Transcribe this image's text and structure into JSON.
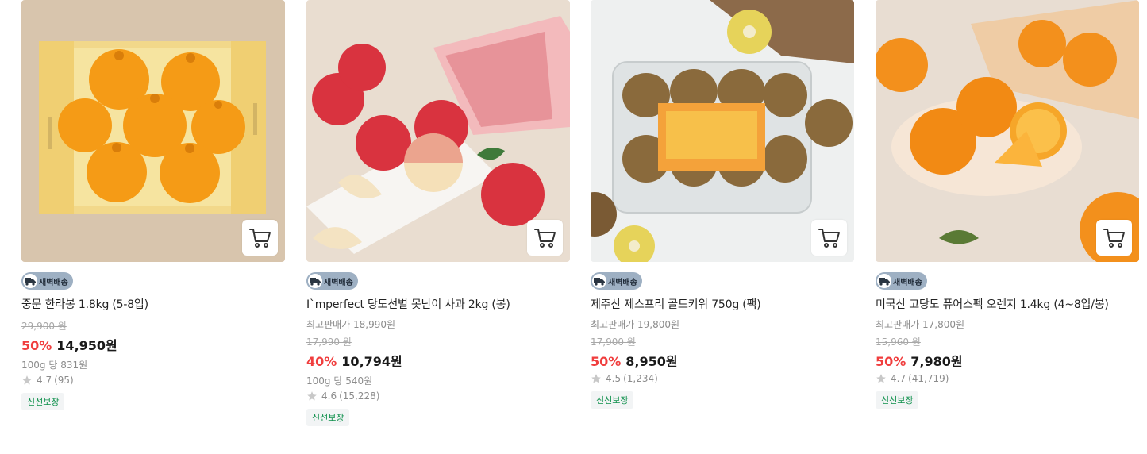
{
  "products": [
    {
      "delivery_badge": "새벽배송",
      "name": "중문 한라봉 1.8kg (5-8입)",
      "original_price": "29,900 원",
      "discount_rate": "50%",
      "price": "14,950원",
      "unit_price": "100g 당 831원",
      "rating": "4.7",
      "review_count": "(95)",
      "tag": "신선보장",
      "image_icon": "hallabong-box-image"
    },
    {
      "delivery_badge": "새벽배송",
      "name": "I`mperfect 당도선별 못난이 사과 2kg (봉)",
      "best_price": "최고판매가 18,990원",
      "original_price": "17,990 원",
      "discount_rate": "40%",
      "price": "10,794원",
      "unit_price": "100g 당 540원",
      "rating": "4.6",
      "review_count": "(15,228)",
      "tag": "신선보장",
      "image_icon": "apples-image"
    },
    {
      "delivery_badge": "새벽배송",
      "name": "제주산 제스프리 골드키위 750g (팩)",
      "best_price": "최고판매가 19,800원",
      "original_price": "17,900 원",
      "discount_rate": "50%",
      "price": "8,950원",
      "rating": "4.5",
      "review_count": "(1,234)",
      "tag": "신선보장",
      "image_icon": "kiwi-pack-image"
    },
    {
      "delivery_badge": "새벽배송",
      "name": "미국산 고당도 퓨어스펙 오렌지 1.4kg (4~8입/봉)",
      "best_price": "최고판매가 17,800원",
      "original_price": "15,960 원",
      "discount_rate": "50%",
      "price": "7,980원",
      "rating": "4.7",
      "review_count": "(41,719)",
      "tag": "신선보장",
      "image_icon": "oranges-image"
    }
  ],
  "colors": {
    "discount": "#f03e3e",
    "badge_bg": "#9eb0c3",
    "fresh_text": "#0c8f4a",
    "star": "#c8c8c8"
  },
  "icons": {
    "cart": "cart-icon",
    "truck": "truck-icon",
    "star": "star-icon"
  }
}
